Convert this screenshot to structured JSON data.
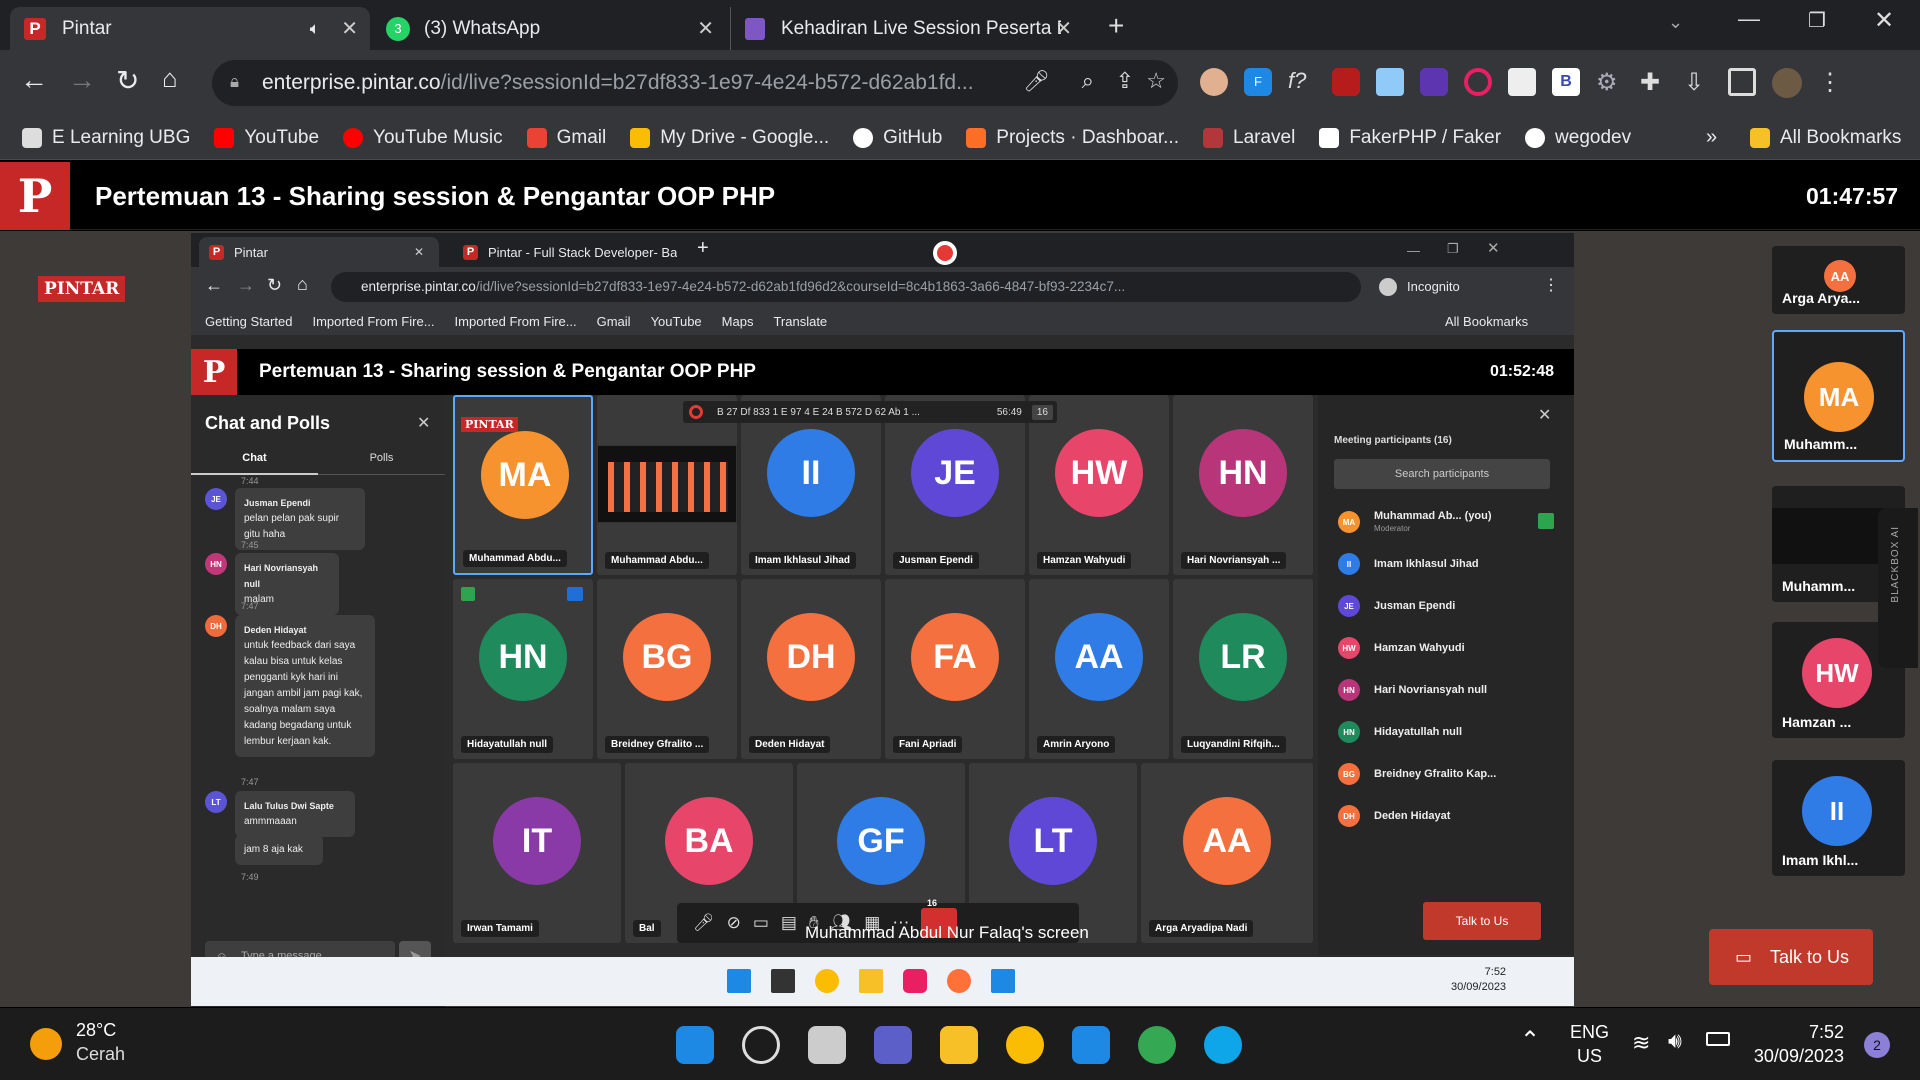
{
  "outer_tabs": [
    {
      "title": "Pintar",
      "icon": "pintar-icon",
      "muted": true
    },
    {
      "title": "(3) WhatsApp",
      "icon": "whatsapp-icon"
    },
    {
      "title": "Kehadiran Live Session Peserta D",
      "icon": "forms-icon"
    }
  ],
  "address": {
    "host": "enterprise.pintar.co",
    "path": "/id/live?sessionId=b27df833-1e97-4e24-b572-d62ab1fd..."
  },
  "bookmarks": [
    "E Learning UBG",
    "YouTube",
    "YouTube Music",
    "Gmail",
    "My Drive - Google...",
    "GitHub",
    "Projects · Dashboar...",
    "Laravel",
    "FakerPHP / Faker",
    "wegodev"
  ],
  "bookmarks_all": "All Bookmarks",
  "header": {
    "logo": "P",
    "title": "Pertemuan 13 - Sharing session & Pengantar OOP PHP",
    "timer": "01:47:57"
  },
  "brand_badge": "PINTAR",
  "inner": {
    "tabs": [
      "Pintar",
      "Pintar - Full Stack Developer- Ba"
    ],
    "address": {
      "host": "enterprise.pintar.co",
      "path": "/id/live?sessionId=b27df833-1e97-4e24-b572-d62ab1fd96d2&courseId=8c4b1863-3a66-4847-bf93-2234c7..."
    },
    "incognito": "Incognito",
    "bookmarks": [
      "Getting Started",
      "Imported From Fire...",
      "Imported From Fire...",
      "Gmail",
      "YouTube",
      "Maps",
      "Translate"
    ],
    "bookmarks_all": "All Bookmarks",
    "title": "Pertemuan 13 - Sharing session & Pengantar OOP PHP",
    "timer": "01:52:48",
    "chat": {
      "title": "Chat and Polls",
      "tab_chat": "Chat",
      "tab_polls": "Polls",
      "messages": [
        {
          "time": "7:44",
          "initials": "JE",
          "name": "Jusman Ependi",
          "text": "pelan pelan pak supir gitu haha",
          "color": "#5b55d6"
        },
        {
          "time": "7:45",
          "initials": "HN",
          "name": "Hari Novriansyah null",
          "text": "malam",
          "color": "#c0387a"
        },
        {
          "time": "7:47",
          "initials": "DH",
          "name": "Deden Hidayat",
          "text": "untuk feedback dari saya kalau bisa untuk kelas pengganti kyk hari ini jangan ambil jam pagi kak, soalnya malam saya kadang begadang untuk lembur kerjaan kak.",
          "color": "#f06a3c"
        },
        {
          "time": "7:47",
          "initials": "LT",
          "name": "Lalu Tulus Dwi Sapte",
          "text": "ammmaaan",
          "color": "#5b55d6"
        },
        {
          "time": "",
          "initials": "",
          "name": "",
          "text": "jam 8 aja kak",
          "color": ""
        }
      ],
      "last_time": "7:49",
      "placeholder": "Type a message"
    },
    "share_bar": {
      "title": "B 27 Df 833 1 E 97 4 E 24 B 572 D 62 Ab 1 ...",
      "time": "56:49",
      "count": "16"
    },
    "tiles": [
      {
        "initials": "MA",
        "name": "Muhammad Abdu...",
        "color": "#f7932f"
      },
      {
        "initials": "",
        "name": "Muhammad Abdu...",
        "color": "#111"
      },
      {
        "initials": "II",
        "name": "Imam Ikhlasul Jihad",
        "color": "#2f7ce6"
      },
      {
        "initials": "JE",
        "name": "Jusman Ependi",
        "color": "#6048d6"
      },
      {
        "initials": "HW",
        "name": "Hamzan Wahyudi",
        "color": "#e8456a"
      },
      {
        "initials": "HN",
        "name": "Hari Novriansyah ...",
        "color": "#b8357a"
      },
      {
        "initials": "HN",
        "name": "Hidayatullah null",
        "color": "#1f8a5c"
      },
      {
        "initials": "BG",
        "name": "Breidney Gfralito ...",
        "color": "#f5703f"
      },
      {
        "initials": "DH",
        "name": "Deden Hidayat",
        "color": "#f5703f"
      },
      {
        "initials": "FA",
        "name": "Fani Apriadi",
        "color": "#f5703f"
      },
      {
        "initials": "AA",
        "name": "Amrin Aryono",
        "color": "#2f7ce6"
      },
      {
        "initials": "LR",
        "name": "Luqyandini Rifqih...",
        "color": "#1f8a5c"
      },
      {
        "initials": "IT",
        "name": "Irwan Tamami",
        "color": "#8a3aa6"
      },
      {
        "initials": "BA",
        "name": "Bal",
        "color": "#e8456a"
      },
      {
        "initials": "GF",
        "name": "",
        "color": "#2f7ce6"
      },
      {
        "initials": "LT",
        "name": "",
        "color": "#6048d6"
      },
      {
        "initials": "AA",
        "name": "Arga Aryadipa Nadi",
        "color": "#f5703f"
      }
    ],
    "screen_label": "Muhammad Abdul Nur Falaq's screen",
    "controls_count": "16",
    "participants": {
      "title": "Meeting participants (16)",
      "search_placeholder": "Search participants",
      "list": [
        {
          "initials": "MA",
          "name": "Muhammad Ab... (you)",
          "role": "Moderator",
          "color": "#f7932f"
        },
        {
          "initials": "II",
          "name": "Imam Ikhlasul Jihad",
          "role": "",
          "color": "#2f7ce6"
        },
        {
          "initials": "JE",
          "name": "Jusman Ependi",
          "role": "",
          "color": "#6048d6"
        },
        {
          "initials": "HW",
          "name": "Hamzan Wahyudi",
          "role": "",
          "color": "#e8456a"
        },
        {
          "initials": "HN",
          "name": "Hari Novriansyah null",
          "role": "",
          "color": "#b8357a"
        },
        {
          "initials": "HN",
          "name": "Hidayatullah null",
          "role": "",
          "color": "#1f8a5c"
        },
        {
          "initials": "BG",
          "name": "Breidney Gfralito Kap...",
          "role": "",
          "color": "#f5703f"
        },
        {
          "initials": "DH",
          "name": "Deden Hidayat",
          "role": "",
          "color": "#f5703f"
        }
      ]
    },
    "talk": "Talk to Us",
    "taskbar_time": "7:52",
    "taskbar_date": "30/09/2023"
  },
  "side_strip": [
    {
      "initials": "AA",
      "name": "Arga Arya...",
      "color": "#f5703f"
    },
    {
      "initials": "MA",
      "name": "Muhamm...",
      "color": "#f7932f"
    },
    {
      "initials": "",
      "name": "Muhamm...",
      "color": "#111"
    },
    {
      "initials": "HW",
      "name": "Hamzan ...",
      "color": "#e8456a"
    },
    {
      "initials": "II",
      "name": "Imam Ikhl...",
      "color": "#2f7ce6"
    }
  ],
  "blackbox": "BLACKBOX AI",
  "talk_to_us": "Talk to Us",
  "taskbar": {
    "weather_temp": "28°C",
    "weather_desc": "Cerah",
    "lang1": "ENG",
    "lang2": "US",
    "time": "7:52",
    "date": "30/09/2023",
    "notif": "2"
  }
}
